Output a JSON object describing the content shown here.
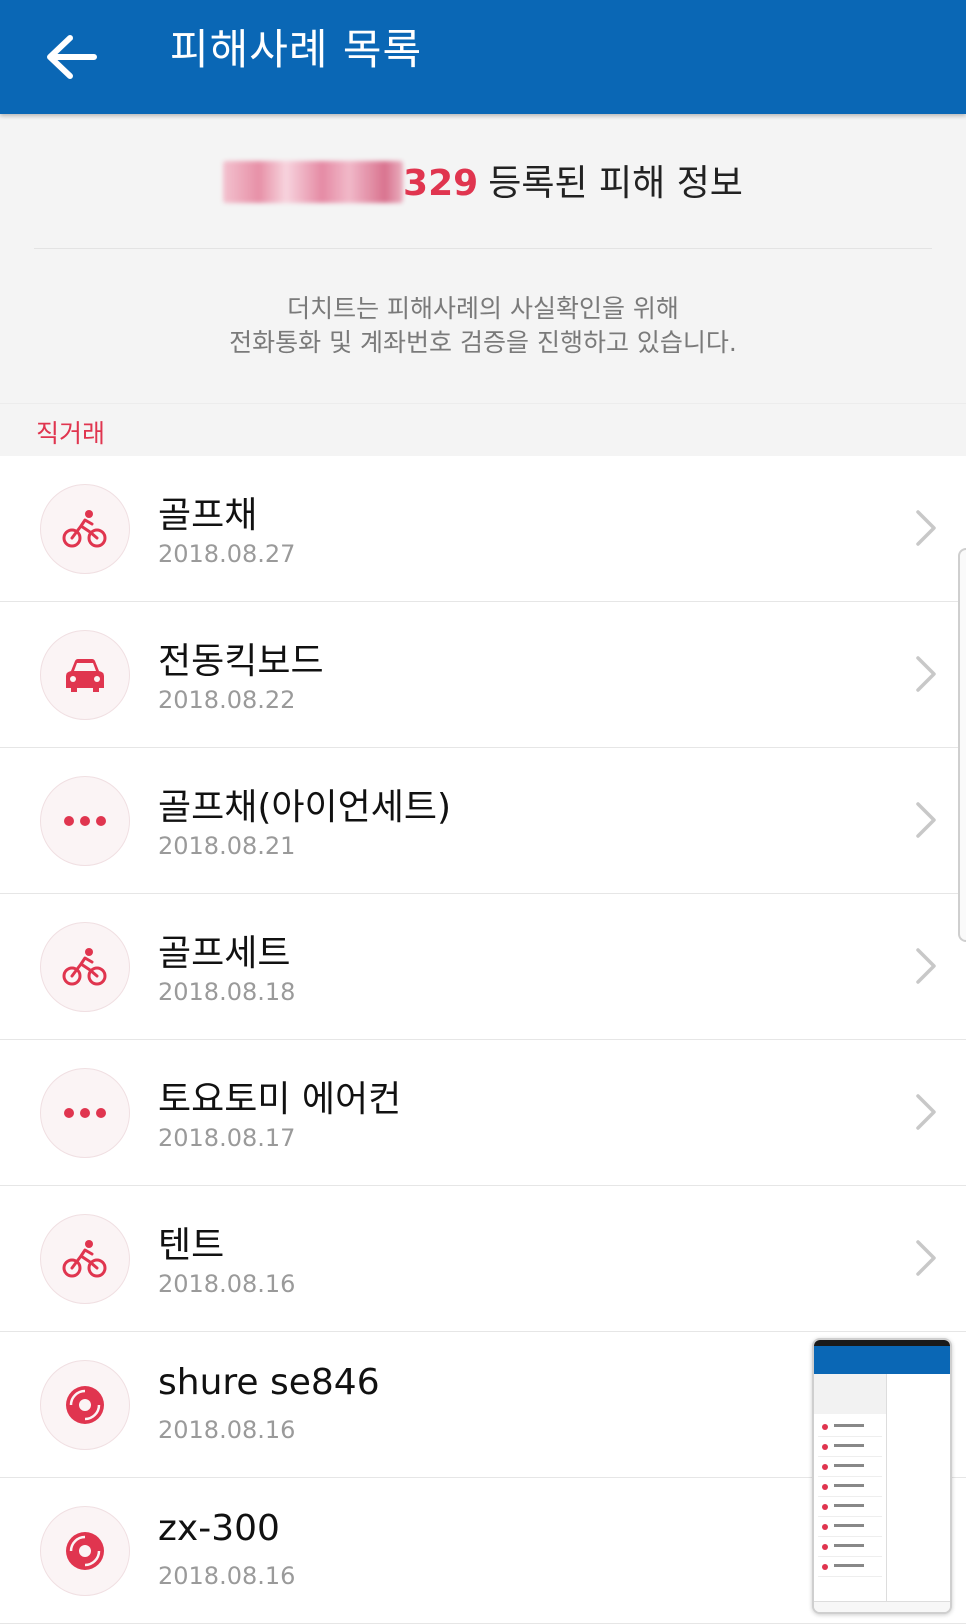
{
  "appbar": {
    "back_icon": "arrow-left-icon",
    "title": "피해사례 목록",
    "color": "#0a67b5"
  },
  "info": {
    "reg_number_tail": "329",
    "reg_suffix": "등록된 피해 정보",
    "notice_line1": "더치트는 피해사례의 사실확인을 위해",
    "notice_line2": "전화통화 및 계좌번호 검증을 진행하고 있습니다."
  },
  "section": {
    "label": "직거래",
    "accent": "#e0354f"
  },
  "items": [
    {
      "name": "골프채",
      "date": "2018.08.27",
      "icon": "bicycle-icon"
    },
    {
      "name": "전동킥보드",
      "date": "2018.08.22",
      "icon": "car-icon"
    },
    {
      "name": "골프채(아이언세트)",
      "date": "2018.08.21",
      "icon": "more-dots-icon"
    },
    {
      "name": "골프세트",
      "date": "2018.08.18",
      "icon": "bicycle-icon"
    },
    {
      "name": "토요토미 에어컨",
      "date": "2018.08.17",
      "icon": "more-dots-icon"
    },
    {
      "name": "텐트",
      "date": "2018.08.16",
      "icon": "bicycle-icon"
    },
    {
      "name": "shure se846",
      "date": "2018.08.16",
      "icon": "disc-icon"
    },
    {
      "name": "zx-300",
      "date": "2018.08.16",
      "icon": "disc-icon"
    }
  ]
}
